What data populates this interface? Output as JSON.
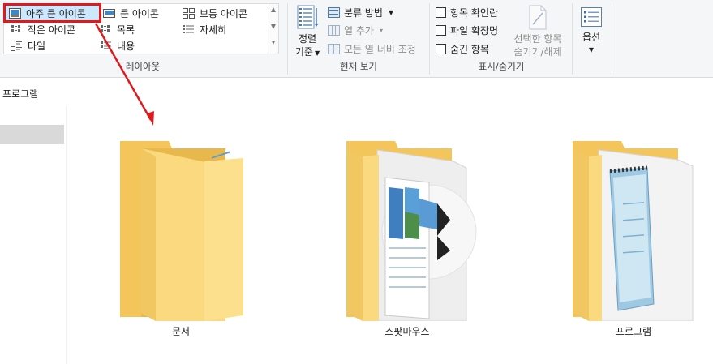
{
  "ribbon": {
    "layout": {
      "items": [
        {
          "label": "아주 큰 아이콘",
          "icon": "extra-large-icons-icon",
          "selected": true
        },
        {
          "label": "큰 아이콘",
          "icon": "large-icons-icon"
        },
        {
          "label": "보통 아이콘",
          "icon": "medium-icons-icon"
        },
        {
          "label": "작은 아이콘",
          "icon": "small-icons-icon"
        },
        {
          "label": "목록",
          "icon": "list-icon"
        },
        {
          "label": "자세히",
          "icon": "details-icon"
        },
        {
          "label": "타일",
          "icon": "tiles-icon"
        },
        {
          "label": "내용",
          "icon": "content-icon"
        }
      ],
      "group_label": "레이아웃"
    },
    "current_view": {
      "sort_line1": "정렬",
      "sort_line2": "기준",
      "group_by": "분류 방법",
      "add_columns": "열 추가",
      "size_all_columns": "모든 열 너비 조정",
      "group_label": "현재 보기"
    },
    "show_hide": {
      "item_checkboxes": "항목 확인란",
      "file_extensions": "파일 확장명",
      "hidden_items": "숨긴 항목",
      "hide_selected_line1": "선택한 항목",
      "hide_selected_line2": "숨기기/해제",
      "group_label": "표시/숨기기"
    },
    "options": {
      "label": "옵션"
    }
  },
  "address": {
    "path": "프로그램"
  },
  "folders": [
    {
      "name": "문서"
    },
    {
      "name": "스팟마우스"
    },
    {
      "name": "프로그램"
    }
  ],
  "colors": {
    "accent_red": "#e0191e",
    "selection_blue": "#cce8ff",
    "folder_back": "#f4c55a",
    "folder_front": "#fbd97e"
  }
}
